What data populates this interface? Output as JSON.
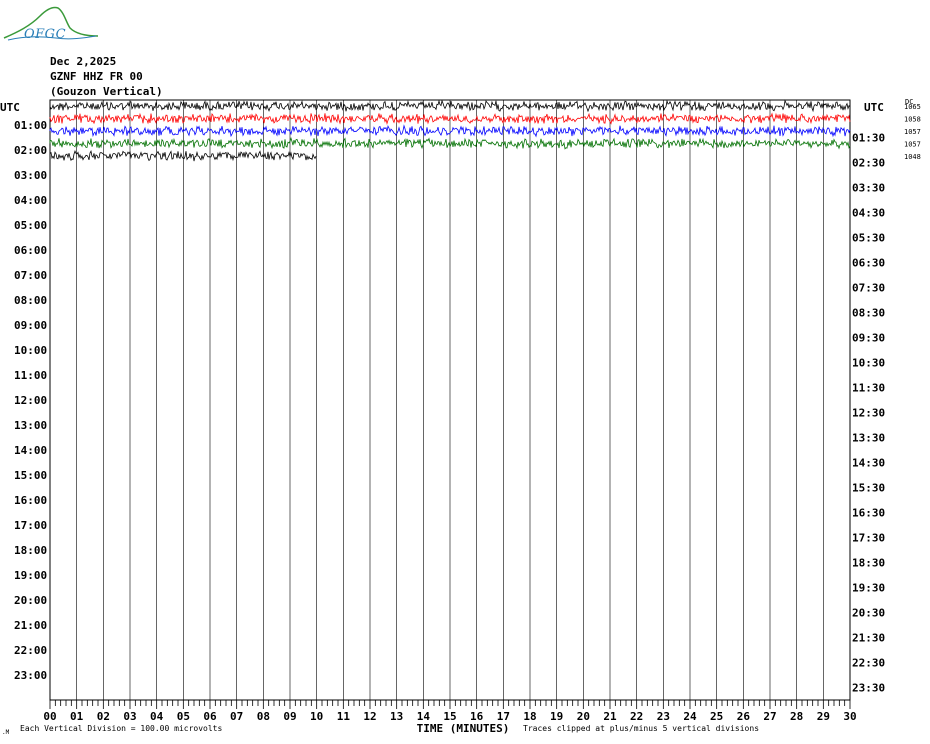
{
  "logo": {
    "text": "OFGC"
  },
  "header": {
    "date": "Dec 2,2025",
    "station": "GZNF HHZ FR 00",
    "location": "(Gouzon Vertical)"
  },
  "chart_data": {
    "type": "line",
    "title": "Dec 2,2025",
    "xlabel": "TIME (MINUTES)",
    "left_axis_title": "UTC",
    "right_axis_title": "UTC",
    "x_ticks": [
      "00",
      "01",
      "02",
      "03",
      "04",
      "05",
      "06",
      "07",
      "08",
      "09",
      "10",
      "11",
      "12",
      "13",
      "14",
      "15",
      "16",
      "17",
      "18",
      "19",
      "20",
      "21",
      "22",
      "23",
      "24",
      "25",
      "26",
      "27",
      "28",
      "29",
      "30"
    ],
    "xlim": [
      0,
      30
    ],
    "left_times": [
      "01:00",
      "02:00",
      "03:00",
      "04:00",
      "05:00",
      "06:00",
      "07:00",
      "08:00",
      "09:00",
      "10:00",
      "11:00",
      "12:00",
      "13:00",
      "14:00",
      "15:00",
      "16:00",
      "17:00",
      "18:00",
      "19:00",
      "20:00",
      "21:00",
      "22:00",
      "23:00"
    ],
    "right_times": [
      "01:30",
      "02:30",
      "03:30",
      "04:30",
      "05:30",
      "06:30",
      "07:30",
      "08:30",
      "09:30",
      "10:30",
      "11:30",
      "12:30",
      "13:30",
      "14:30",
      "15:30",
      "16:30",
      "17:30",
      "18:30",
      "19:30",
      "20:30",
      "21:30",
      "22:30",
      "23:30"
    ],
    "dc_label": "DC",
    "traces": [
      {
        "row": 0,
        "color": "#000000",
        "start_min": 0,
        "end_min": 30,
        "dc": "1065"
      },
      {
        "row": 1,
        "color": "#ff0000",
        "start_min": 0,
        "end_min": 30,
        "dc": "1058"
      },
      {
        "row": 2,
        "color": "#0000ff",
        "start_min": 0,
        "end_min": 30,
        "dc": "1057"
      },
      {
        "row": 3,
        "color": "#007000",
        "start_min": 0,
        "end_min": 30,
        "dc": "1057"
      },
      {
        "row": 4,
        "color": "#000000",
        "start_min": 0,
        "end_min": 10,
        "dc": "1048"
      }
    ],
    "footer_left": "Each Vertical Division =  100.00 microvolts",
    "footer_right": "Traces clipped at plus/minus 5 vertical divisions"
  }
}
